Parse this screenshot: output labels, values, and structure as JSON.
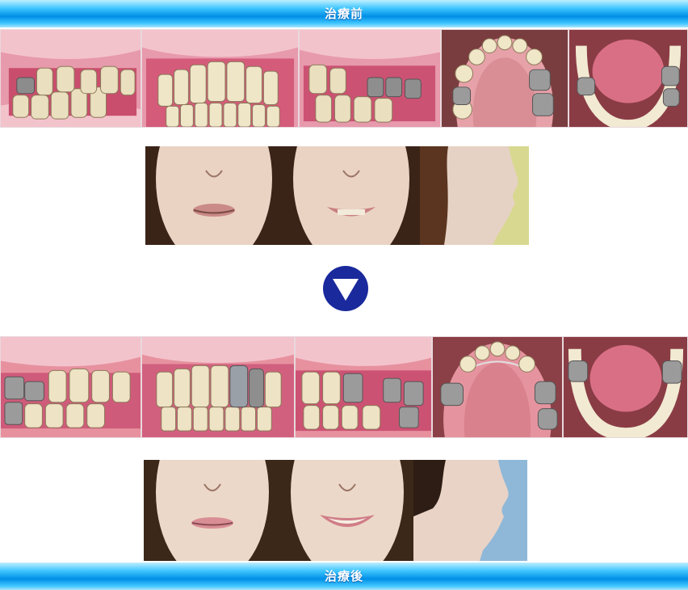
{
  "header": {
    "title": "治療前"
  },
  "footer": {
    "title": "治療後"
  },
  "before": {
    "intraoral_photos": [
      "right-buccal",
      "frontal",
      "left-buccal",
      "upper-occlusal",
      "lower-occlusal"
    ],
    "facial_photos": [
      "frontal-rest",
      "frontal-smile",
      "profile"
    ]
  },
  "after": {
    "intraoral_photos": [
      "right-buccal",
      "frontal",
      "left-buccal",
      "upper-occlusal",
      "lower-occlusal"
    ],
    "facial_photos": [
      "frontal-rest",
      "frontal-smile",
      "profile"
    ]
  },
  "colors": {
    "banner": "#1da9f2",
    "arrow": "#1a2a9c",
    "gum": "#d7577a",
    "tooth": "#f2ead2",
    "skin": "#ecd7c6",
    "hair": "#3a2418"
  }
}
